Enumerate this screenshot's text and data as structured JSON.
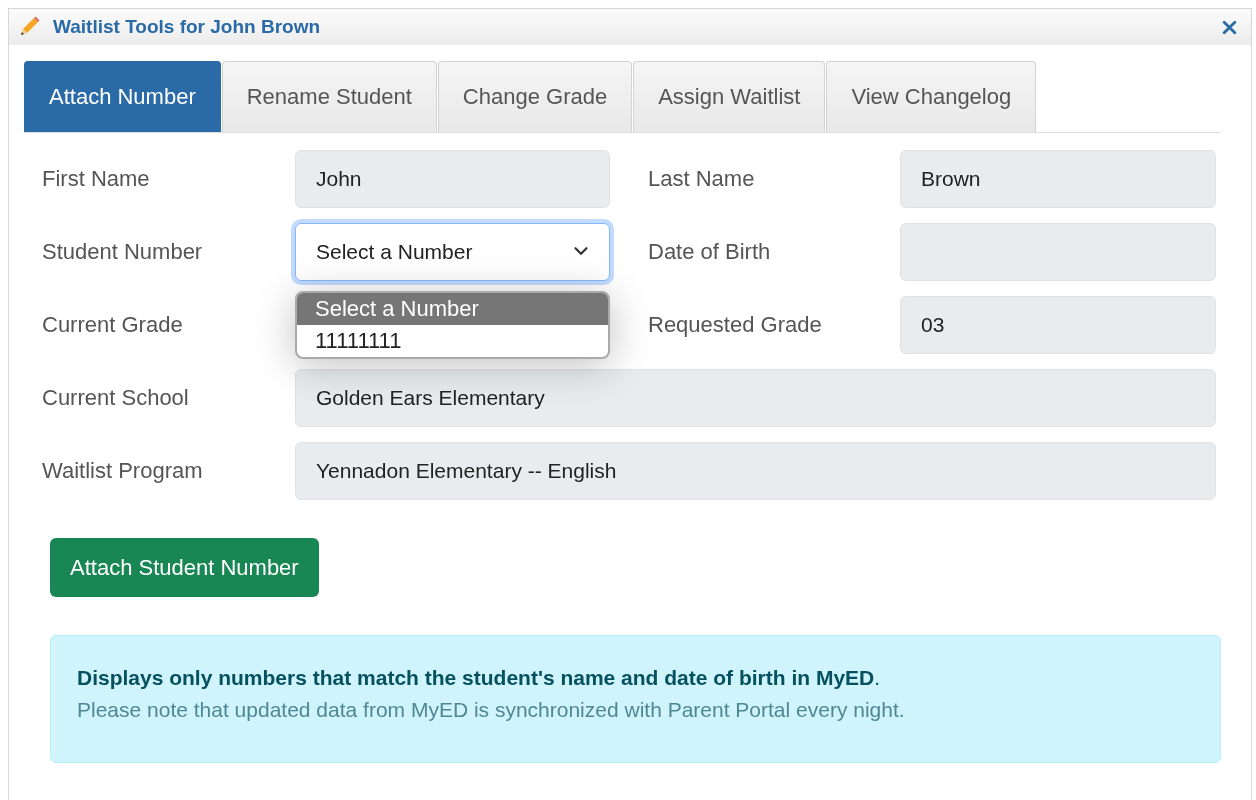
{
  "window": {
    "title": "Waitlist Tools for John Brown"
  },
  "tabs": [
    {
      "label": "Attach Number",
      "selected": true
    },
    {
      "label": "Rename Student",
      "selected": false
    },
    {
      "label": "Change Grade",
      "selected": false
    },
    {
      "label": "Assign Waitlist",
      "selected": false
    },
    {
      "label": "View Changelog",
      "selected": false
    }
  ],
  "rows": [
    {
      "fields": [
        {
          "label": "First Name",
          "kind": "text",
          "value": "John"
        },
        {
          "label": "Last Name",
          "kind": "text",
          "value": "Brown"
        }
      ]
    },
    {
      "fields": [
        {
          "label": "Student Number",
          "kind": "select",
          "value": "Select a Number",
          "expanded": true,
          "options": [
            {
              "label": "Select a Number",
              "selected": true
            },
            {
              "label": "11111111",
              "selected": false
            }
          ]
        },
        {
          "label": "Date of Birth",
          "kind": "text"
        }
      ]
    },
    {
      "fields": [
        {
          "label": "Current Grade",
          "kind": "text"
        },
        {
          "label": "Requested Grade",
          "kind": "text",
          "value": "03"
        }
      ]
    },
    {
      "fields": [
        {
          "label": "Current School",
          "kind": "text",
          "value": "Golden Ears Elementary"
        }
      ]
    },
    {
      "fields": [
        {
          "label": "Waitlist Program",
          "kind": "text",
          "value": "Yennadon Elementary -- English"
        }
      ]
    }
  ],
  "action_button": "Attach Student Number",
  "info": {
    "lines": [
      "**Displays only numbers that match the student's name and date of birth in MyED**.",
      "Please note that updated data from MyED is synchronized with Parent Portal every night."
    ]
  }
}
